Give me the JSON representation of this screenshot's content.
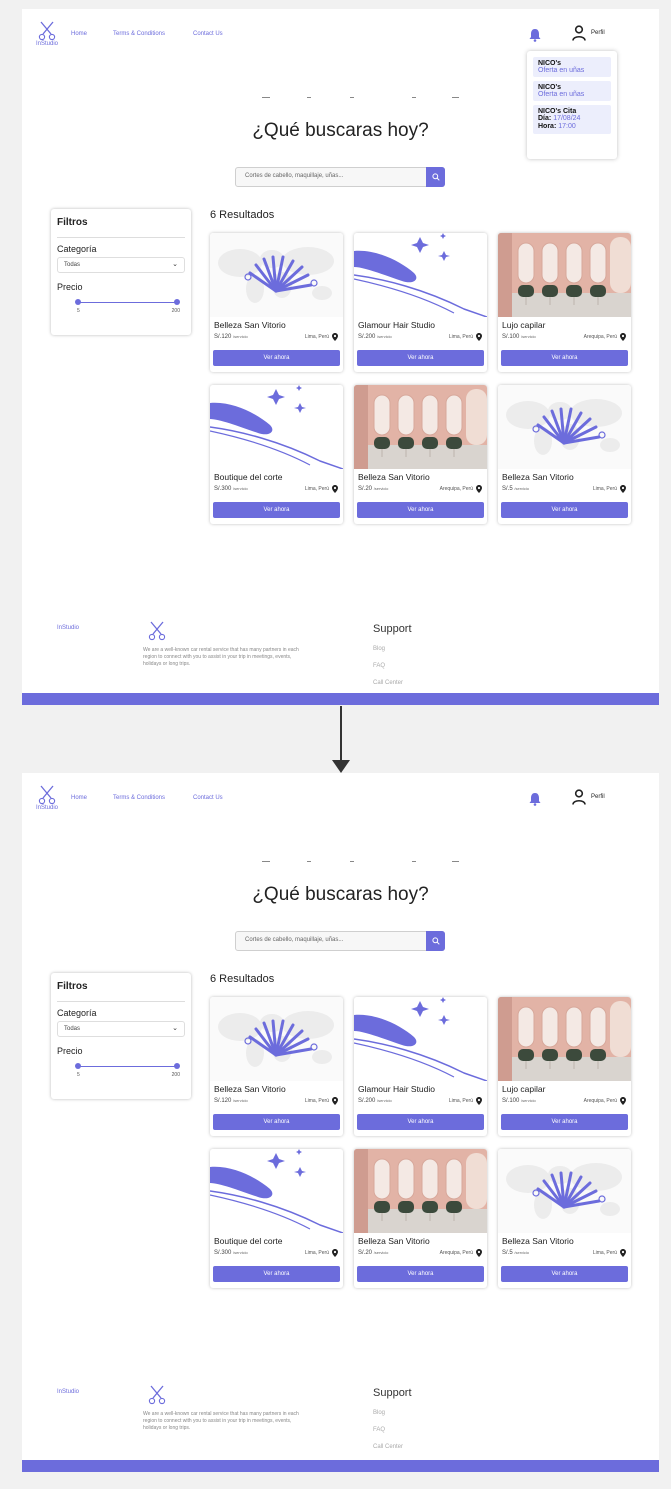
{
  "nav": {
    "logo_text": "InStudio",
    "links": [
      "Home",
      "Terms & Conditions",
      "Contact Us"
    ],
    "profile_label": "Perfil"
  },
  "notifications": [
    {
      "title": "NICO's",
      "subtitle": "Oferta  en uñas"
    },
    {
      "title": "NICO's",
      "subtitle": "Oferta  en uñas"
    }
  ],
  "appointment": {
    "title": "NICO's Cita",
    "day_label": "Día:",
    "day_value": "17/08/24",
    "hour_label": "Hora:",
    "hour_value": "17:00"
  },
  "hero": {
    "title": "¿Qué buscaras hoy?"
  },
  "search": {
    "placeholder": "Cortes de cabello, maquillaje, uñas..."
  },
  "filters": {
    "title": "Filtros",
    "category_label": "Categoría",
    "category_value": "Todas",
    "price_label": "Precio",
    "price_min": "5",
    "price_max": "200"
  },
  "results_label": "6 Resultados",
  "cards": [
    {
      "name": "Belleza San Vitorio",
      "price": "S/.120",
      "per": "/servicio",
      "location": "Lima, Perú",
      "button": "Ver ahora",
      "image": "tools-map-illustration"
    },
    {
      "name": "Glamour Hair Studio",
      "price": "S/.200",
      "per": "/servicio",
      "location": "Lima, Perú",
      "button": "Ver ahora",
      "image": "sparkle-dryer-illustration"
    },
    {
      "name": "Lujo capilar",
      "price": "S/.100",
      "per": "/servicio",
      "location": "Arequipa, Perú",
      "button": "Ver ahora",
      "image": "salon-interior-photo"
    },
    {
      "name": "Boutique del corte",
      "price": "S/.300",
      "per": "/servicio",
      "location": "Lima, Perú",
      "button": "Ver ahora",
      "image": "sparkle-dryer-illustration"
    },
    {
      "name": "Belleza San Vitorio",
      "price": "S/.20",
      "per": "/servicio",
      "location": "Arequipa, Perú",
      "button": "Ver ahora",
      "image": "salon-interior-photo"
    },
    {
      "name": "Belleza San Vitorio",
      "price": "S/.5",
      "per": "/servicio",
      "location": "Lima, Perú",
      "button": "Ver ahora",
      "image": "tools-map-illustration"
    }
  ],
  "footer": {
    "brand": "InStudio",
    "description": "We are a well-known car rental service that has many partners in each region to connect with you to assist in your trip in meetings, events, holidays or long trips.",
    "support_title": "Support",
    "support_links": [
      "Blog",
      "FAQ",
      "Call Center"
    ]
  },
  "colors": {
    "accent": "#6c6cdc",
    "background": "#f1f1f1"
  }
}
